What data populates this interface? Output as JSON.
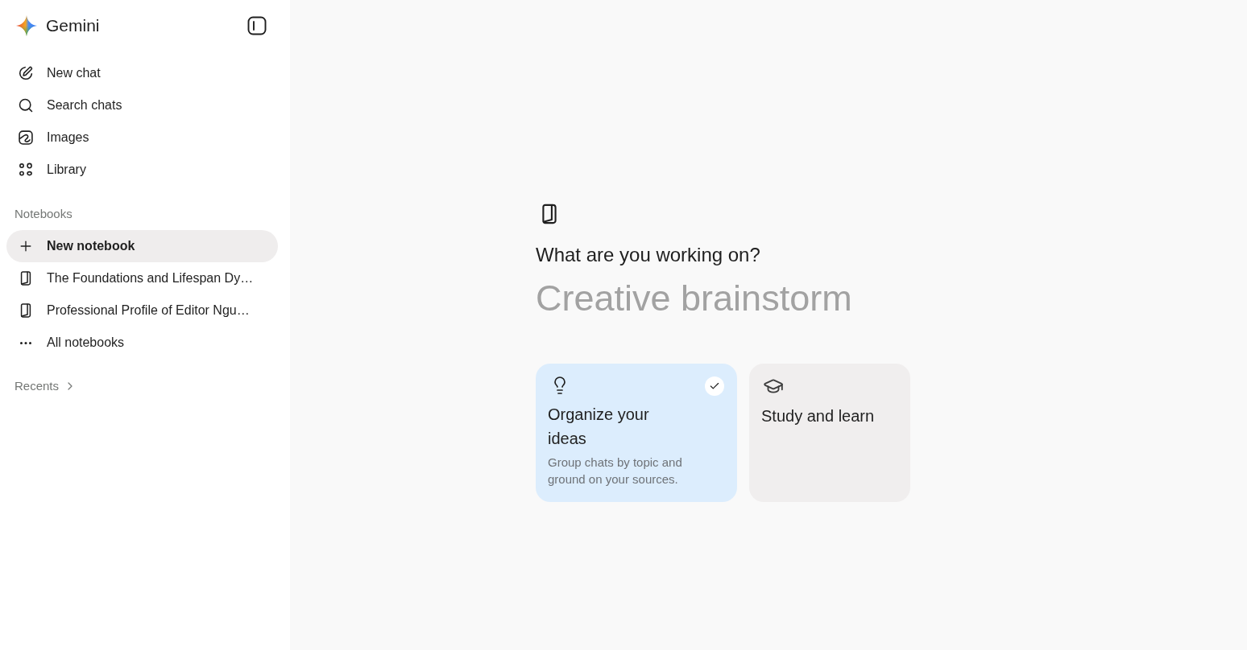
{
  "sidebar": {
    "logo": {
      "title": "Gemini"
    },
    "nav_items": [
      {
        "label": "New chat",
        "kind": "compose"
      },
      {
        "label": "Search chats",
        "kind": "search"
      },
      {
        "label": "Images",
        "kind": "images"
      },
      {
        "label": "Library",
        "kind": "library"
      }
    ],
    "notebooks_heading": "Notebooks",
    "notebook_items": [
      {
        "label": "New notebook",
        "kind": "create",
        "selected": true
      },
      {
        "label": "The Foundations and Lifespan Dy…",
        "kind": "notebook",
        "selected": false
      },
      {
        "label": "Professional Profile of Editor Ngu…",
        "kind": "notebook",
        "selected": false
      },
      {
        "label": "All notebooks",
        "kind": "more",
        "selected": false
      }
    ],
    "recents_heading": "Recents"
  },
  "main": {
    "heading": "What are you working on?",
    "input": {
      "placeholder": "Creative brainstorm"
    },
    "cards": [
      {
        "kind": "organize",
        "title": "Organize your ideas",
        "description": "Group chats by topic and ground on your sources.",
        "selected": true
      },
      {
        "kind": "study",
        "title": "Study and learn",
        "selected": false
      }
    ]
  }
}
